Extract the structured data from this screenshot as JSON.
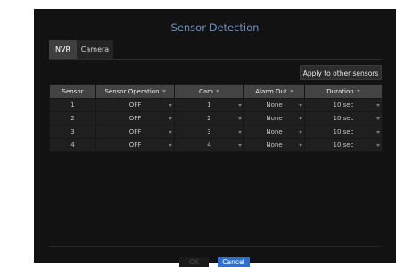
{
  "dialog": {
    "title": "Sensor Detection"
  },
  "tabs": [
    {
      "label": "NVR",
      "active": true
    },
    {
      "label": "Camera",
      "active": false
    }
  ],
  "apply_button": "Apply to other sensors",
  "table": {
    "headers": [
      "Sensor",
      "Sensor Operation",
      "Cam",
      "Alarm Out",
      "Duration"
    ],
    "rows": [
      {
        "sensor": "1",
        "operation": "OFF",
        "cam": "1",
        "alarm_out": "None",
        "duration": "10 sec"
      },
      {
        "sensor": "2",
        "operation": "OFF",
        "cam": "2",
        "alarm_out": "None",
        "duration": "10 sec"
      },
      {
        "sensor": "3",
        "operation": "OFF",
        "cam": "3",
        "alarm_out": "None",
        "duration": "10 sec"
      },
      {
        "sensor": "4",
        "operation": "OFF",
        "cam": "4",
        "alarm_out": "None",
        "duration": "10 sec"
      }
    ]
  },
  "footer": {
    "ok_label": "OK",
    "cancel_label": "Cancel"
  },
  "colors": {
    "title": "#6c93c7",
    "dialog_bg": "#121212",
    "header_bg": "#434343",
    "cell_bg": "#1f1f1f",
    "cancel_bg": "#2e6fd4"
  }
}
